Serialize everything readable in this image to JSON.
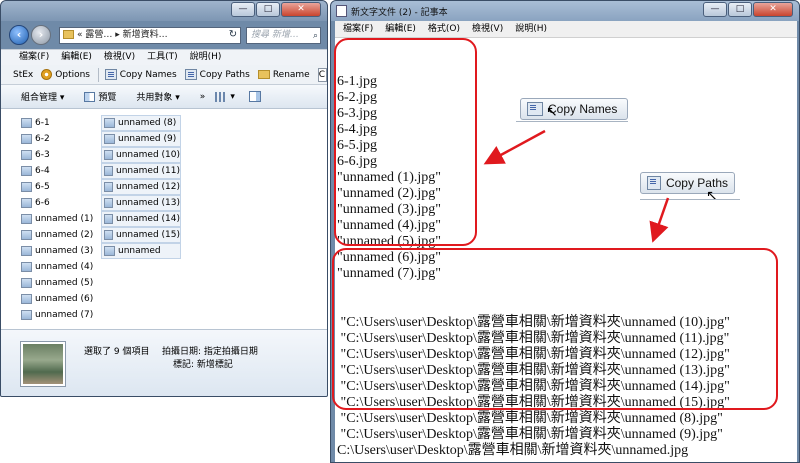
{
  "explorer": {
    "window_controls": {
      "minimize": "—",
      "maximize": "□",
      "close": "✕"
    },
    "address": "« 露營… ▸ 新增資料…",
    "search_placeholder": "搜尋 新增…",
    "menu": [
      "檔案(F)",
      "編輯(E)",
      "檢視(V)",
      "工具(T)",
      "說明(H)"
    ],
    "toolbar1": {
      "stex": "StEx",
      "options": "Options",
      "copy_names": "Copy Names",
      "copy_paths": "Copy Paths",
      "rename": "Rename",
      "cut_field": "C"
    },
    "toolbar2": {
      "organize": "組合管理 ▾",
      "preview": "預覽",
      "share": "共用對象 ▾",
      "more": "»"
    },
    "files_col1": [
      "6-1",
      "6-2",
      "6-3",
      "6-4",
      "6-5",
      "6-6",
      "unnamed (1)",
      "unnamed (2)",
      "unnamed (3)",
      "unnamed (4)",
      "unnamed (5)",
      "unnamed (6)",
      "unnamed (7)"
    ],
    "files_col2": [
      "unnamed (8)",
      "unnamed (9)",
      "unnamed (10)",
      "unnamed (11)",
      "unnamed (12)",
      "unnamed (13)",
      "unnamed (14)",
      "unnamed (15)",
      "unnamed"
    ],
    "details": {
      "selected": "選取了 9 個項目",
      "date": "拍攝日期:  指定拍攝日期",
      "tags": "標記:  新增標記"
    }
  },
  "notepad": {
    "title": "新文字文件 (2) - 記事本",
    "window_controls": {
      "minimize": "—",
      "maximize": "□",
      "close": "✕"
    },
    "menu": [
      "檔案(F)",
      "編輯(E)",
      "格式(O)",
      "檢視(V)",
      "說明(H)"
    ],
    "names_lines": [
      "6-1.jpg",
      "6-2.jpg",
      "6-3.jpg",
      "6-4.jpg",
      "6-5.jpg",
      "6-6.jpg",
      "\"unnamed (1).jpg\"",
      "\"unnamed (2).jpg\"",
      "\"unnamed (3).jpg\"",
      "\"unnamed (4).jpg\"",
      "\"unnamed (5).jpg\"",
      "\"unnamed (6).jpg\"",
      "\"unnamed (7).jpg\""
    ],
    "path_lines": [
      " \"C:\\Users\\user\\Desktop\\露營車相關\\新增資料夾\\unnamed (10).jpg\"",
      " \"C:\\Users\\user\\Desktop\\露營車相關\\新增資料夾\\unnamed (11).jpg\"",
      " \"C:\\Users\\user\\Desktop\\露營車相關\\新增資料夾\\unnamed (12).jpg\"",
      " \"C:\\Users\\user\\Desktop\\露營車相關\\新增資料夾\\unnamed (13).jpg\"",
      " \"C:\\Users\\user\\Desktop\\露營車相關\\新增資料夾\\unnamed (14).jpg\"",
      " \"C:\\Users\\user\\Desktop\\露營車相關\\新增資料夾\\unnamed (15).jpg\"",
      " \"C:\\Users\\user\\Desktop\\露營車相關\\新增資料夾\\unnamed (8).jpg\"",
      " \"C:\\Users\\user\\Desktop\\露營車相關\\新增資料夾\\unnamed (9).jpg\"",
      "C:\\Users\\user\\Desktop\\露營車相關\\新增資料夾\\unnamed.jpg"
    ]
  },
  "overlays": {
    "copy_names_button": "Copy Names",
    "copy_paths_button": "Copy Paths",
    "file_icon_label": "File",
    "path_icon_label": "Path",
    "highlight_color": "#e0191e"
  }
}
